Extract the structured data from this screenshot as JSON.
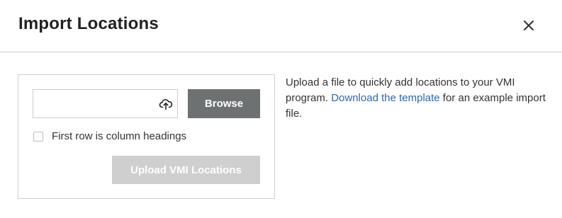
{
  "dialog": {
    "title": "Import Locations",
    "close_icon": "close-icon"
  },
  "import_panel": {
    "file_input": {
      "value": "",
      "icon": "upload-cloud-icon"
    },
    "browse_label": "Browse",
    "checkbox": {
      "label": "First row is column headings",
      "checked": false
    },
    "upload_label": "Upload VMI Locations",
    "upload_disabled": true
  },
  "description": {
    "text_before": "Upload a file to quickly add locations to your VMI program. ",
    "link_text": "Download the template",
    "text_after": " for an example import file."
  },
  "colors": {
    "browse_bg": "#6e7172",
    "upload_disabled_bg": "#cfcfcf",
    "link": "#2a6ab0"
  }
}
